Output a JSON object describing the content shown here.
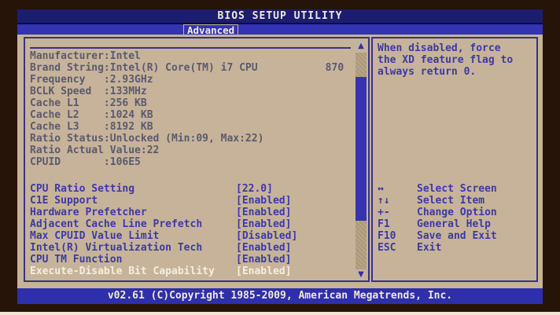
{
  "title_bar": {
    "title": "BIOS SETUP UTILITY"
  },
  "menu": {
    "active_tab": "Advanced"
  },
  "cpu_info": {
    "lines": [
      "Manufacturer:Intel",
      "Brand String:Intel(R) Core(TM) i7 CPU           870",
      "Frequency   :2.93GHz",
      "BCLK Speed  :133MHz",
      "Cache L1    :256 KB",
      "Cache L2    :1024 KB",
      "Cache L3    :8192 KB",
      "Ratio Status:Unlocked (Min:09, Max:22)",
      "Ratio Actual Value:22",
      "CPUID       :106E5"
    ]
  },
  "settings": [
    {
      "label": "CPU Ratio Setting",
      "value": "[22.0]"
    },
    {
      "label": "C1E Support",
      "value": "[Enabled]"
    },
    {
      "label": "Hardware Prefetcher",
      "value": "[Enabled]"
    },
    {
      "label": "Adjacent Cache Line Prefetch",
      "value": "[Enabled]"
    },
    {
      "label": "Max CPUID Value Limit",
      "value": "[Disabled]"
    },
    {
      "label": "Intel(R) Virtualization Tech",
      "value": "[Enabled]"
    },
    {
      "label": "CPU TM Function",
      "value": "[Enabled]"
    },
    {
      "label": "Execute-Disable Bit Capability",
      "value": "[Enabled]",
      "selected": true
    }
  ],
  "help_panel": {
    "lines": [
      "When disabled, force",
      "the XD feature flag to",
      "always return 0."
    ]
  },
  "legend": [
    {
      "keys": "↔",
      "action": "Select Screen"
    },
    {
      "keys": "↑↓",
      "action": "Select Item"
    },
    {
      "keys": "+-",
      "action": "Change Option"
    },
    {
      "keys": "F1",
      "action": "General Help"
    },
    {
      "keys": "F10",
      "action": "Save and Exit"
    },
    {
      "keys": "ESC",
      "action": "Exit"
    }
  ],
  "scrollbar": {
    "up_icon": "▲",
    "down_icon": "▼"
  },
  "footer": {
    "copyright": "v02.61 (C)Copyright 1985-2009, American Megatrends, Inc."
  },
  "colors": {
    "bezel": "#261408",
    "background_tan": "#c7b399",
    "title_bar_blue": "#1d1d70",
    "menu_bar_blue": "#3234b4",
    "panel_border": "#3a3183",
    "setting_text_blue": "#3c3aa6",
    "info_text_gray": "#5a5a70",
    "selected_text": "#f4eedf",
    "footer_blue": "#2d2fab"
  }
}
